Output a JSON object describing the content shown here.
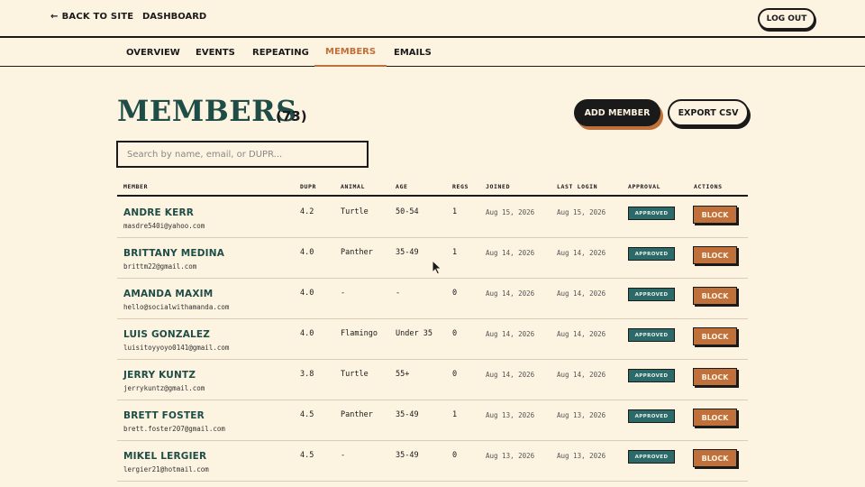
{
  "nav": {
    "back": "BACK TO SITE",
    "dashboard": "DASHBOARD",
    "logout": "LOG OUT"
  },
  "tabs": [
    "OVERVIEW",
    "EVENTS",
    "REPEATING",
    "MEMBERS",
    "EMAILS"
  ],
  "active_tab": "MEMBERS",
  "page": {
    "title": "MEMBERS",
    "count": "(73)",
    "add_button": "ADD MEMBER",
    "export_button": "EXPORT CSV"
  },
  "search": {
    "placeholder": "Search by name, email, or DUPR...",
    "value": ""
  },
  "columns": [
    "MEMBER",
    "DUPR",
    "ANIMAL",
    "AGE",
    "REGS",
    "JOINED",
    "LAST LOGIN",
    "APPROVAL",
    "ACTIONS"
  ],
  "rows": [
    {
      "name": "ANDRE KERR",
      "email": "masdre540i@yahoo.com",
      "dupr": "4.2",
      "animal": "Turtle",
      "age": "50-54",
      "regs": "1",
      "joined": "Aug 15, 2026",
      "last_login": "Aug 15, 2026",
      "approval": "APPROVED",
      "action": "BLOCK"
    },
    {
      "name": "BRITTANY MEDINA",
      "email": "brittm22@gmail.com",
      "dupr": "4.0",
      "animal": "Panther",
      "age": "35-49",
      "regs": "1",
      "joined": "Aug 14, 2026",
      "last_login": "Aug 14, 2026",
      "approval": "APPROVED",
      "action": "BLOCK"
    },
    {
      "name": "AMANDA MAXIM",
      "email": "hello@socialwithamanda.com",
      "dupr": "4.0",
      "animal": "-",
      "age": "-",
      "regs": "0",
      "joined": "Aug 14, 2026",
      "last_login": "Aug 14, 2026",
      "approval": "APPROVED",
      "action": "BLOCK"
    },
    {
      "name": "LUIS GONZALEZ",
      "email": "luisitoyyoyo0141@gmail.com",
      "dupr": "4.0",
      "animal": "Flamingo",
      "age": "Under 35",
      "regs": "0",
      "joined": "Aug 14, 2026",
      "last_login": "Aug 14, 2026",
      "approval": "APPROVED",
      "action": "BLOCK"
    },
    {
      "name": "JERRY KUNTZ",
      "email": "jerrykuntz@gmail.com",
      "dupr": "3.8",
      "animal": "Turtle",
      "age": "55+",
      "regs": "0",
      "joined": "Aug 14, 2026",
      "last_login": "Aug 14, 2026",
      "approval": "APPROVED",
      "action": "BLOCK"
    },
    {
      "name": "BRETT FOSTER",
      "email": "brett.foster207@gmail.com",
      "dupr": "4.5",
      "animal": "Panther",
      "age": "35-49",
      "regs": "1",
      "joined": "Aug 13, 2026",
      "last_login": "Aug 13, 2026",
      "approval": "APPROVED",
      "action": "BLOCK"
    },
    {
      "name": "MIKEL LERGIER",
      "email": "lergier21@hotmail.com",
      "dupr": "4.5",
      "animal": "-",
      "age": "35-49",
      "regs": "0",
      "joined": "Aug 13, 2026",
      "last_login": "Aug 13, 2026",
      "approval": "APPROVED",
      "action": "BLOCK"
    }
  ],
  "colors": {
    "background": "#fdf3e1",
    "title": "#1e4d47",
    "accent": "#c0703a",
    "approved": "#2c6a6a"
  }
}
